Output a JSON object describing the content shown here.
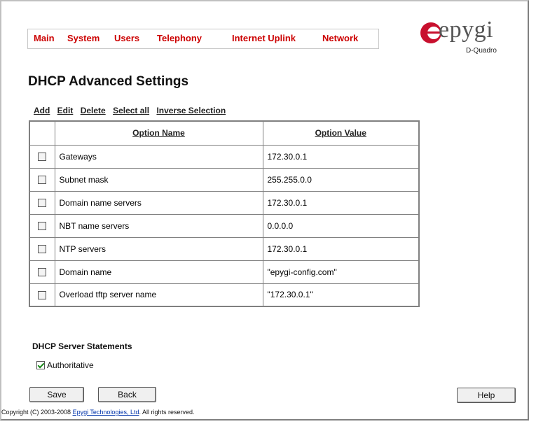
{
  "nav": {
    "items": [
      "Main",
      "System",
      "Users",
      "Telephony",
      "Internet Uplink",
      "Network"
    ]
  },
  "logo": {
    "word": "epygi",
    "sub": "D-Quadro"
  },
  "page_title": "DHCP Advanced Settings",
  "actions": [
    "Add",
    "Edit",
    "Delete",
    "Select all",
    "Inverse Selection"
  ],
  "table": {
    "headers": [
      "Option Name",
      "Option Value"
    ],
    "rows": [
      {
        "name": "Gateways",
        "value": "172.30.0.1"
      },
      {
        "name": "Subnet mask",
        "value": "255.255.0.0"
      },
      {
        "name": "Domain name servers",
        "value": "172.30.0.1"
      },
      {
        "name": "NBT name servers",
        "value": "0.0.0.0"
      },
      {
        "name": "NTP servers",
        "value": "172.30.0.1"
      },
      {
        "name": "Domain name",
        "value": "\"epygi-config.com\""
      },
      {
        "name": "Overload tftp server name",
        "value": "\"172.30.0.1\""
      }
    ]
  },
  "statements": {
    "title": "DHCP Server Statements",
    "authoritative_label": "Authoritative",
    "authoritative_checked": true
  },
  "buttons": {
    "save": "Save",
    "back": "Back",
    "help": "Help"
  },
  "copyright": {
    "prefix": "Copyright (C) 2003-2008 ",
    "link": "Epygi Technologies, Ltd",
    "suffix": ". All rights reserved."
  }
}
